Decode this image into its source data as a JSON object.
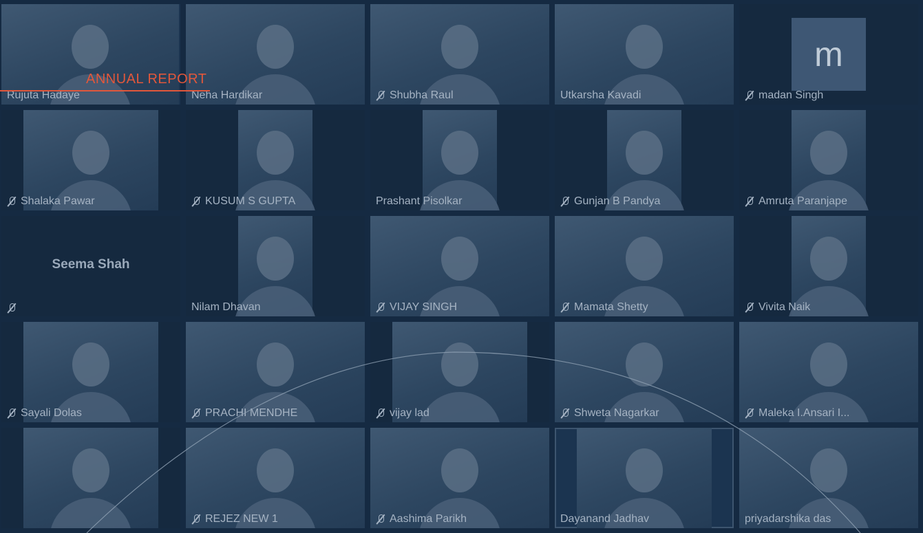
{
  "header": {
    "title": "ANNUAL REPORT"
  },
  "participants": [
    {
      "name": "Rujuta Hadaye",
      "muted": false
    },
    {
      "name": "Neha Hardikar",
      "muted": false
    },
    {
      "name": "Shubha Raul",
      "muted": true
    },
    {
      "name": "Utkarsha Kavadi",
      "muted": false
    },
    {
      "name": "madan Singh",
      "muted": true,
      "avatar_letter": "m"
    },
    {
      "name": "Shalaka Pawar",
      "muted": true
    },
    {
      "name": "KUSUM S GUPTA",
      "muted": true
    },
    {
      "name": "Prashant Pisolkar",
      "muted": false
    },
    {
      "name": "Gunjan B Pandya",
      "muted": true
    },
    {
      "name": "Amruta Paranjape",
      "muted": true
    },
    {
      "name": "Seema Shah",
      "muted": true,
      "video_off": true
    },
    {
      "name": "Nilam Dhavan",
      "muted": false
    },
    {
      "name": "VIJAY SINGH",
      "muted": true
    },
    {
      "name": "Mamata Shetty",
      "muted": true
    },
    {
      "name": "Vivita Naik",
      "muted": true
    },
    {
      "name": "Sayali Dolas",
      "muted": true
    },
    {
      "name": "PRACHI MENDHE",
      "muted": true
    },
    {
      "name": "vijay lad",
      "muted": true
    },
    {
      "name": "Shweta Nagarkar",
      "muted": true
    },
    {
      "name": "Maleka I.Ansari I...",
      "muted": true
    },
    {
      "name": "",
      "muted": false
    },
    {
      "name": "REJEZ NEW 1",
      "muted": true
    },
    {
      "name": "Aashima Parikh",
      "muted": true
    },
    {
      "name": "Dayanand Jadhav",
      "muted": false
    },
    {
      "name": "priyadarshika das",
      "muted": false
    }
  ]
}
